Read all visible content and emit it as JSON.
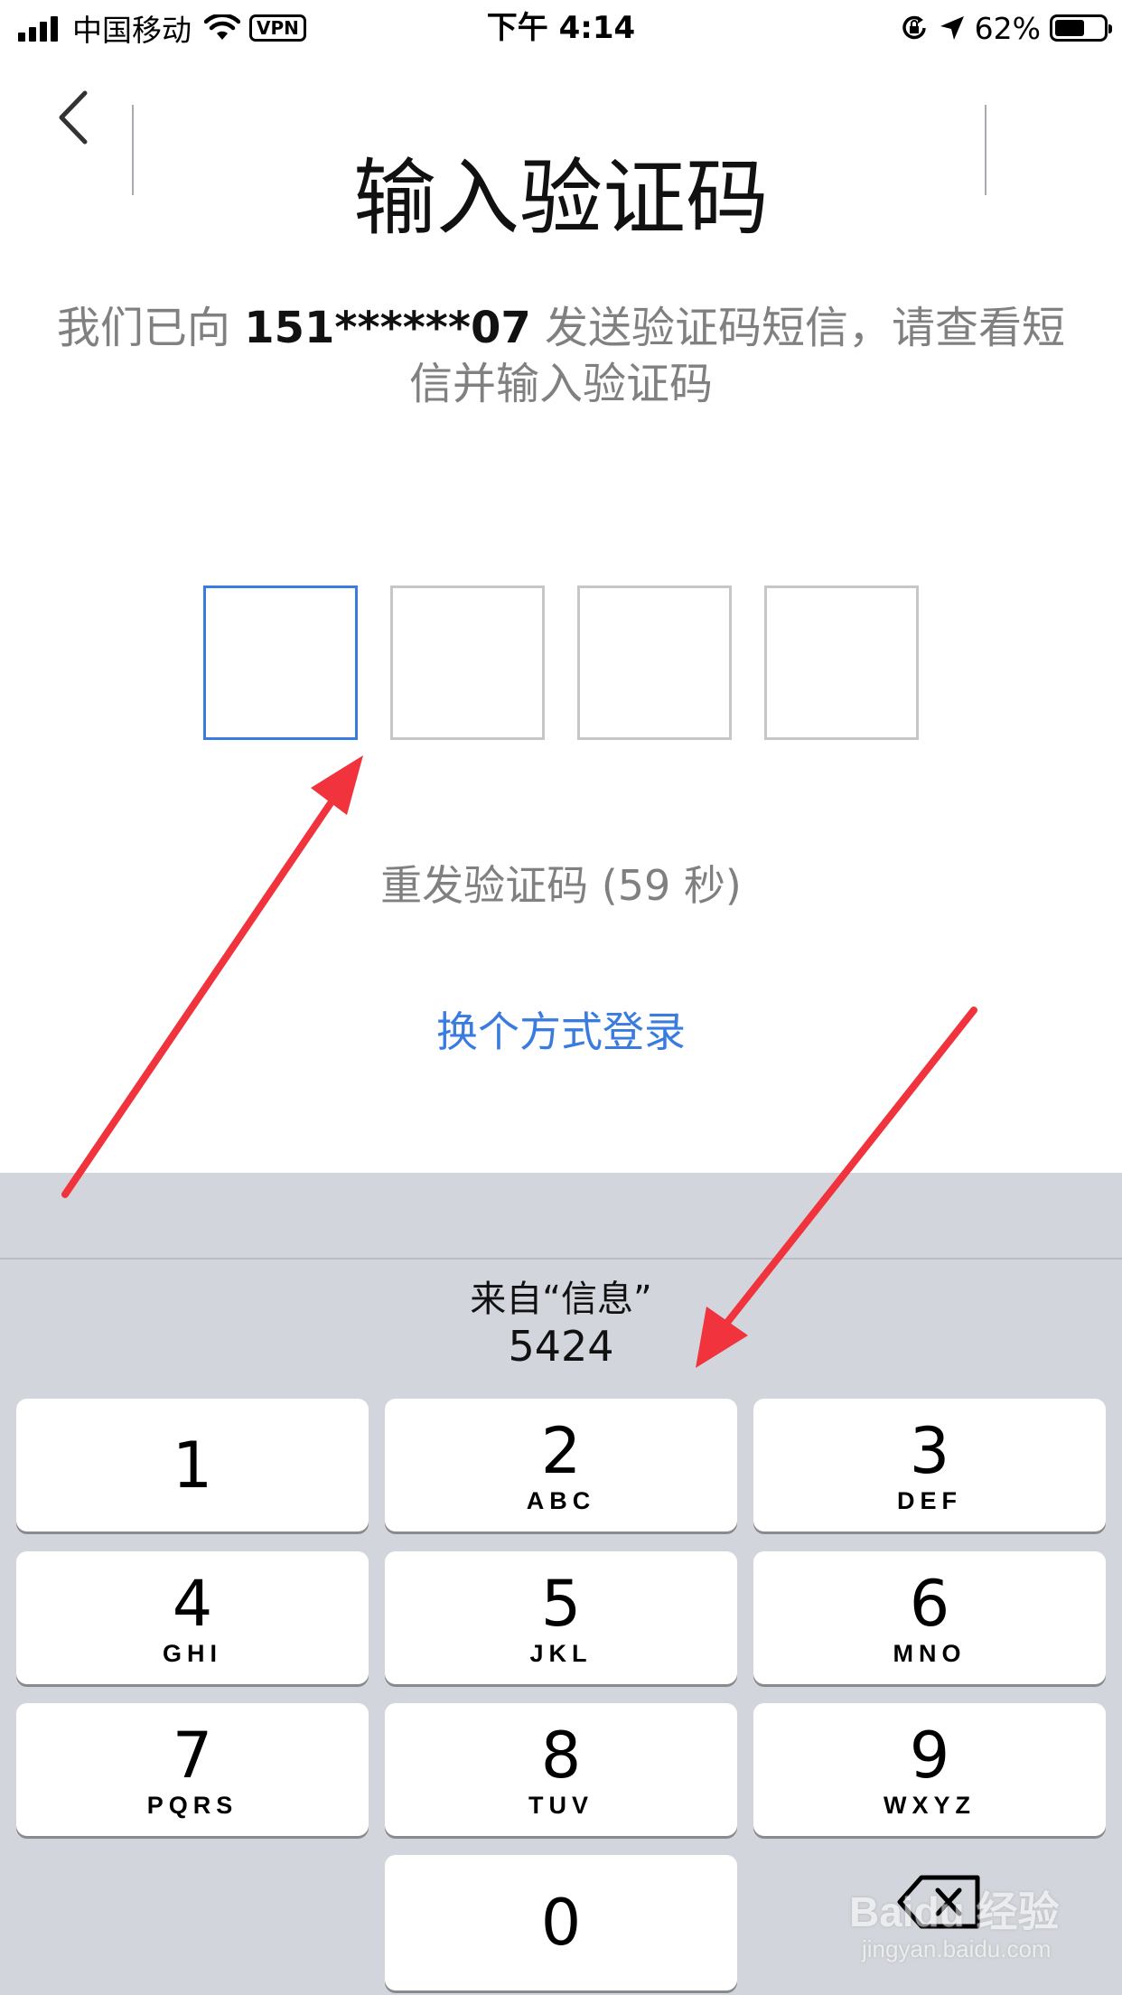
{
  "status_bar": {
    "carrier": "中国移动",
    "vpn": "VPN",
    "time": "下午 4:14",
    "battery": "62%"
  },
  "header": {
    "back_icon": "chevron-left-icon",
    "title": "输入验证码"
  },
  "message": {
    "prefix": "我们已向 ",
    "phone": "151******07",
    "suffix": " 发送验证码短信，请查看短信并输入验证码"
  },
  "code_input": {
    "box_count": 4,
    "active_index": 0,
    "active_color": "#3a7be0",
    "border_color": "#c6c6c6"
  },
  "resend_label": "重发验证码 (59 秒)",
  "switch_login_label": "换个方式登录",
  "keyboard": {
    "suggestion_source": "来自“信息”",
    "suggestion_code": "5424",
    "keys": [
      {
        "digit": "1",
        "letters": ""
      },
      {
        "digit": "2",
        "letters": "ABC"
      },
      {
        "digit": "3",
        "letters": "DEF"
      },
      {
        "digit": "4",
        "letters": "GHI"
      },
      {
        "digit": "5",
        "letters": "JKL"
      },
      {
        "digit": "6",
        "letters": "MNO"
      },
      {
        "digit": "7",
        "letters": "PQRS"
      },
      {
        "digit": "8",
        "letters": "TUV"
      },
      {
        "digit": "9",
        "letters": "WXYZ"
      },
      {
        "digit": "0",
        "letters": ""
      }
    ],
    "delete_icon": "backspace-icon"
  },
  "annotation": {
    "arrow_color": "#f0333c"
  },
  "watermark": {
    "brand": "Baidu 经验",
    "url": "jingyan.baidu.com"
  },
  "colors": {
    "accent": "#3a7be0",
    "muted_text": "#808080",
    "keyboard_bg": "#d2d5db"
  }
}
